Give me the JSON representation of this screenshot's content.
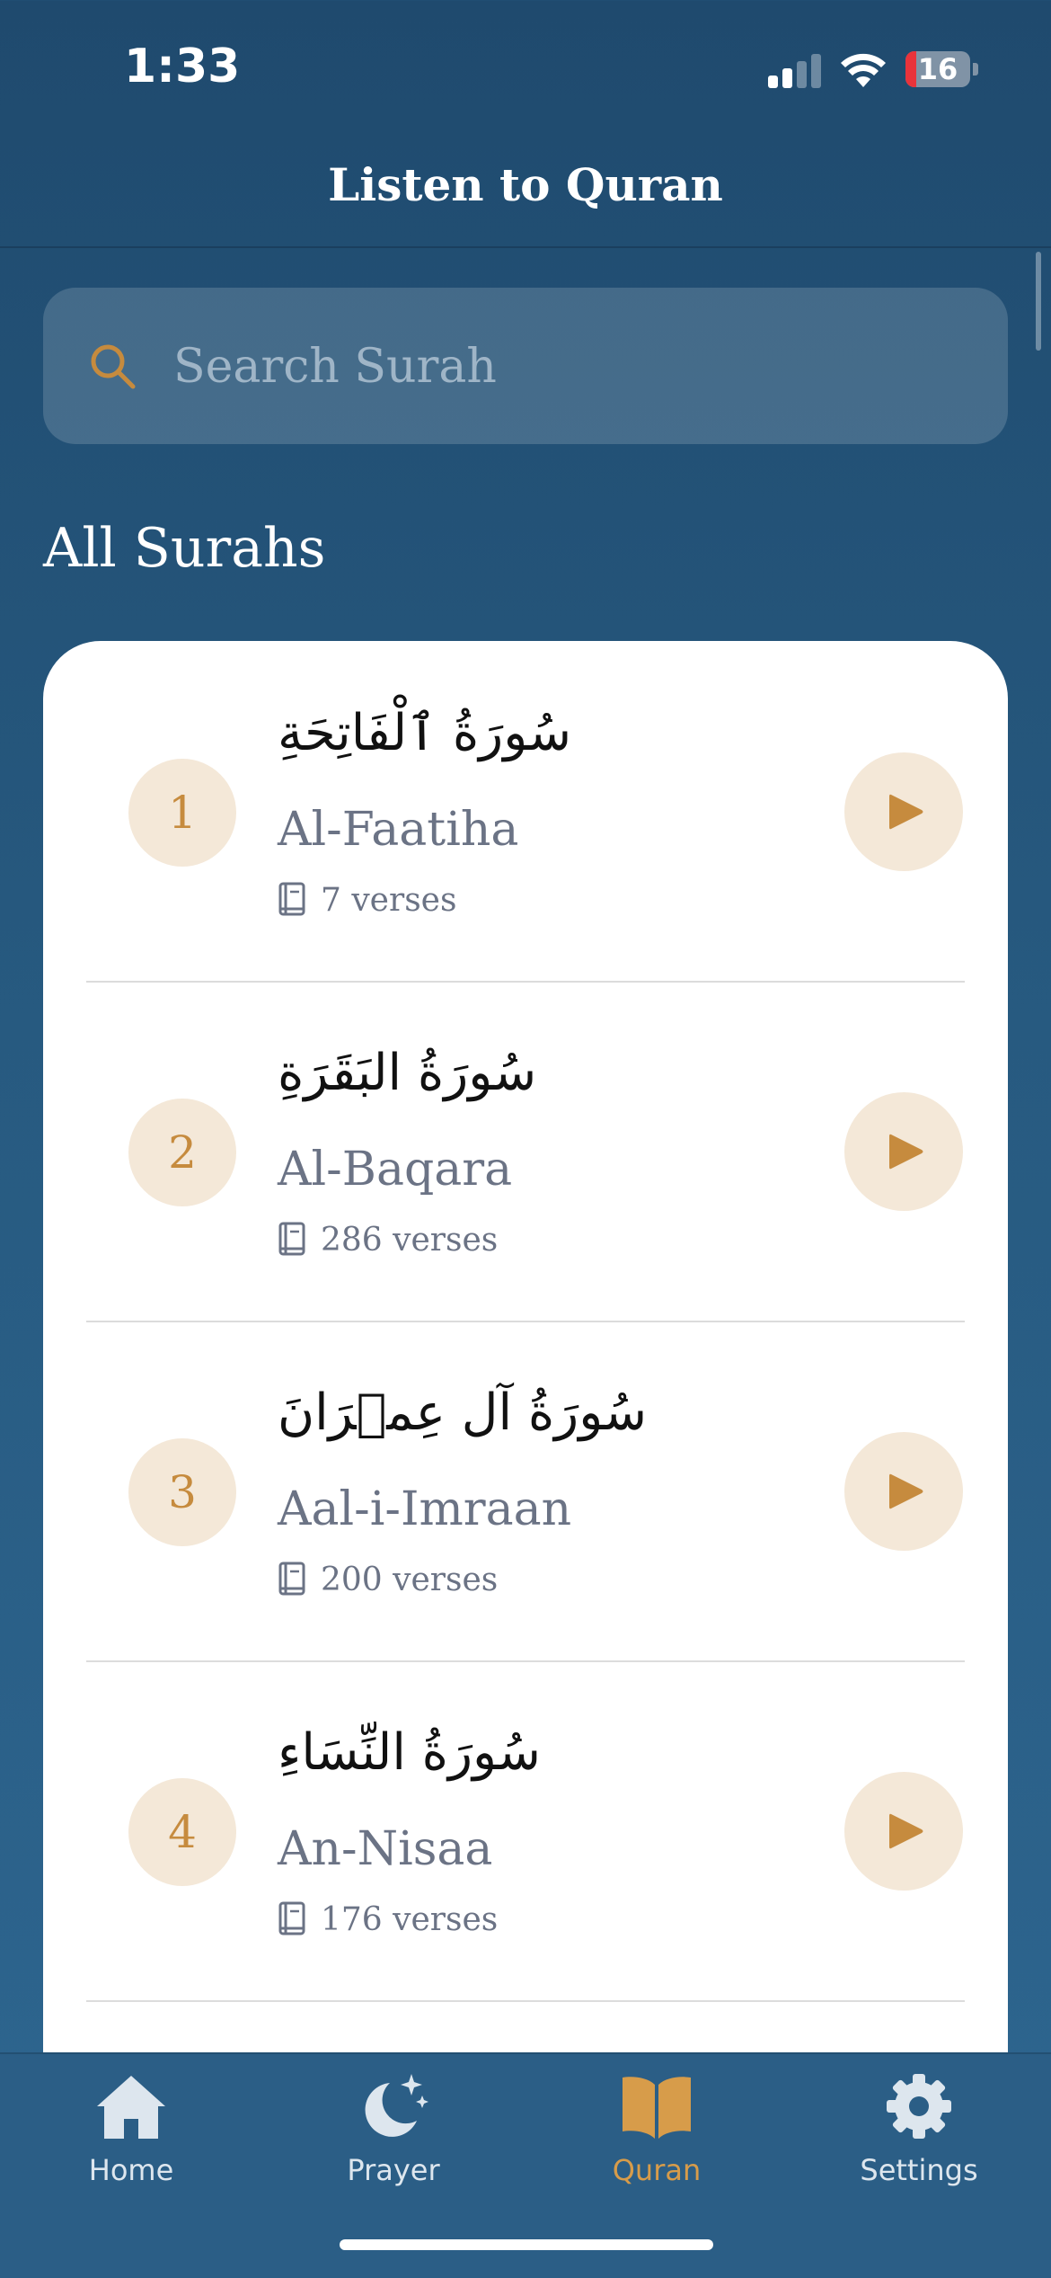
{
  "status_bar": {
    "time": "1:33",
    "battery_level": "16",
    "battery_fraction": 0.16,
    "battery_color": "#e9333b",
    "signal_bars_active": 2
  },
  "header": {
    "title": "Listen to Quran"
  },
  "search": {
    "placeholder": "Search Surah",
    "value": ""
  },
  "section": {
    "title": "All Surahs"
  },
  "surahs": [
    {
      "number": "1",
      "arabic": "سُورَةُ ٱلْفَاتِحَةِ",
      "name": "Al-Faatiha",
      "verses": "7 verses"
    },
    {
      "number": "2",
      "arabic": "سُورَةُ البَقَرَةِ",
      "name": "Al-Baqara",
      "verses": "286 verses"
    },
    {
      "number": "3",
      "arabic": "سُورَةُ آل عِمۡرَانَ",
      "name": "Aal-i-Imraan",
      "verses": "200 verses"
    },
    {
      "number": "4",
      "arabic": "سُورَةُ النِّسَاءِ",
      "name": "An-Nisaa",
      "verses": "176 verses"
    }
  ],
  "tabs": [
    {
      "label": "Home",
      "icon": "home-icon"
    },
    {
      "label": "Prayer",
      "icon": "moon-stars-icon"
    },
    {
      "label": "Quran",
      "icon": "book-open-icon",
      "active": true
    },
    {
      "label": "Settings",
      "icon": "gear-icon"
    }
  ],
  "colors": {
    "accent": "#c68b3e",
    "active_tab": "#d79c4a",
    "badge_bg": "#f4e8d8",
    "background": "#275a80"
  }
}
